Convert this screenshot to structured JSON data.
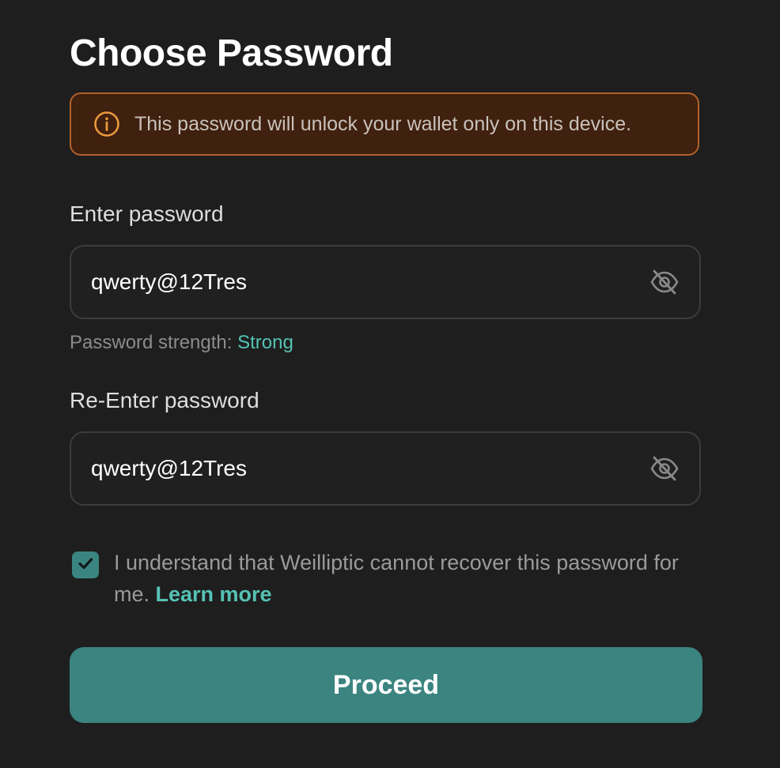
{
  "title": "Choose Password",
  "warning": {
    "icon": "info-icon",
    "text": "This password will unlock your wallet only on this device."
  },
  "password_field": {
    "label": "Enter password",
    "value": "qwerty@12Tres",
    "toggle_icon": "eye-slash-icon"
  },
  "strength": {
    "label": "Password strength: ",
    "value": "Strong"
  },
  "confirm_field": {
    "label": "Re-Enter password",
    "value": "qwerty@12Tres",
    "toggle_icon": "eye-slash-icon"
  },
  "consent": {
    "checked": true,
    "text": "I understand that Weilliptic cannot recover this password for me. ",
    "link": "Learn more"
  },
  "proceed_label": "Proceed",
  "colors": {
    "background": "#1e1e1e",
    "accent": "#3b8480",
    "accent_text": "#55c2b4",
    "warning_bg": "#40200e",
    "warning_border": "#b0612e",
    "warning_icon": "#e99a3c"
  }
}
